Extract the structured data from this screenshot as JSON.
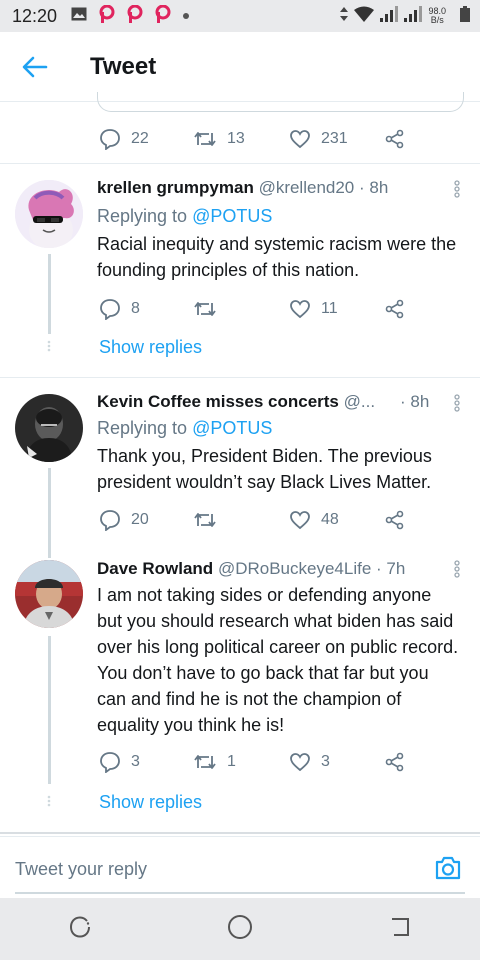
{
  "status_bar": {
    "time": "12:20",
    "net_speed_value": "98.0",
    "net_speed_unit": "B/s",
    "icons": [
      "image-icon",
      "p-icon",
      "p-icon",
      "p-icon",
      "dot-icon",
      "data-arrows-icon",
      "wifi-icon",
      "signal-icon",
      "signal-icon",
      "battery-icon"
    ]
  },
  "header": {
    "title": "Tweet"
  },
  "top_tweet": {
    "replies": "22",
    "retweets": "13",
    "likes": "231"
  },
  "replies": [
    {
      "name": "krellen grumpyman",
      "handle": "@krellend20",
      "time": "· 8h",
      "replying_prefix": "Replying to",
      "replying_to": "@POTUS",
      "text": "Racial inequity and systemic racism were the founding principles of this nation.",
      "reply_count": "8",
      "retweet_count": "",
      "like_count": "11",
      "show_replies": "Show replies"
    },
    {
      "name": "Kevin Coffee misses concerts",
      "handle": "@...",
      "time": "· 8h",
      "replying_prefix": "Replying to",
      "replying_to": "@POTUS",
      "text": "Thank you, President Biden. The previous president wouldn’t say Black Lives Matter.",
      "reply_count": "20",
      "retweet_count": "",
      "like_count": "48"
    },
    {
      "name": "Dave Rowland",
      "handle": "@DRoBuckeye4Life",
      "time": "· 7h",
      "text": "I am not taking sides or defending anyone but you should research what biden has said over his long political career on public record. You don’t have to go back that far but you can and find he is not the champion of equality you think he is!",
      "reply_count": "3",
      "retweet_count": "1",
      "like_count": "3",
      "show_replies": "Show replies"
    }
  ],
  "compose": {
    "placeholder": "Tweet your reply"
  },
  "colors": {
    "accent": "#1da1f2",
    "muted": "#657786",
    "status_bar_bg": "#e9eaec"
  }
}
